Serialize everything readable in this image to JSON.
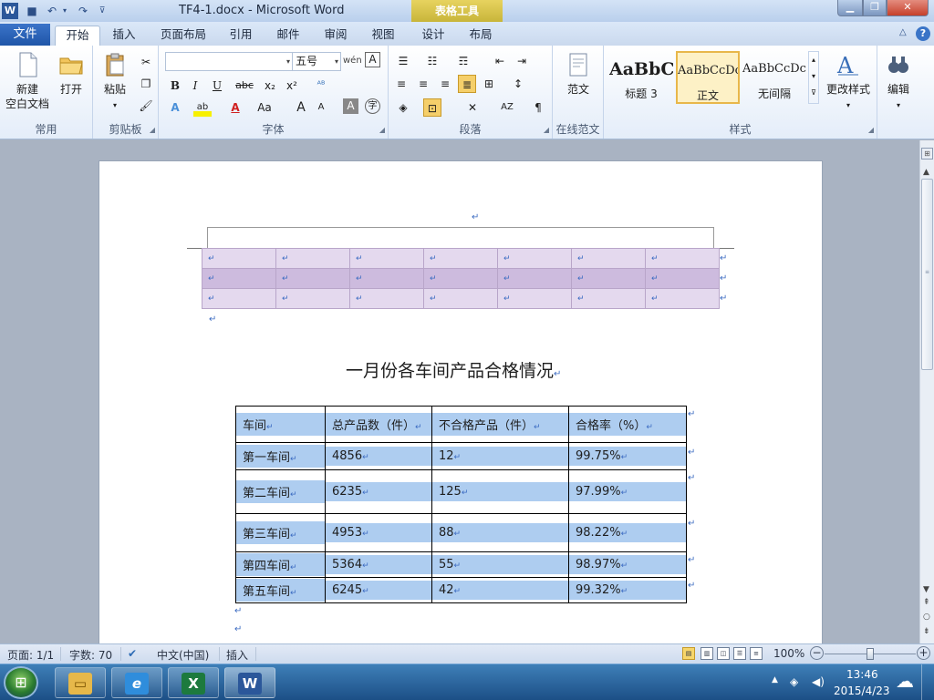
{
  "window": {
    "title": "TF4-1.docx - Microsoft Word",
    "context_tab": "表格工具",
    "logo_letter": "W",
    "minimize": "▁",
    "maximize": "❐",
    "close": "✕"
  },
  "qat": {
    "save": "■",
    "undo": "↶",
    "dropdown": "▾",
    "redo": "↷",
    "customize": "⊽"
  },
  "tabs": {
    "file": "文件",
    "items": [
      "开始",
      "插入",
      "页面布局",
      "引用",
      "邮件",
      "审阅",
      "视图",
      "设计",
      "布局"
    ],
    "help": "?",
    "minimize_ribbon": "△"
  },
  "ribbon": {
    "common": {
      "label": "常用",
      "new_line1": "新建",
      "new_line2": "空白文档",
      "open": "打开"
    },
    "clipboard": {
      "label": "剪贴板",
      "paste": "粘贴"
    },
    "font": {
      "label": "字体",
      "font_name": "",
      "font_size": "五号",
      "bold": "B",
      "italic": "I",
      "underline": "U",
      "strike": "abc",
      "sub": "x₂",
      "sup": "x²",
      "grow": "A",
      "shrink": "A",
      "case": "Aa"
    },
    "paragraph": {
      "label": "段落"
    },
    "template": {
      "label": "在线范文",
      "button": "范文"
    },
    "styles": {
      "label": "样式",
      "items": [
        {
          "sample": "AaBbC",
          "name": "标题 3"
        },
        {
          "sample": "AaBbCcDc",
          "name": "正文"
        },
        {
          "sample": "AaBbCcDc",
          "name": "无间隔"
        }
      ],
      "change_styles": "更改样式"
    },
    "editing": {
      "label": "编辑"
    }
  },
  "document": {
    "paragraph_mark": "↵",
    "title": "一月份各车间产品合格情况",
    "table_headers": [
      "车间",
      "总产品数（件）",
      "不合格产品（件）",
      "合格率（%）"
    ],
    "table_rows": [
      [
        "第一车间",
        "4856",
        "12",
        "99.75%"
      ],
      [
        "第二车间",
        "6235",
        "125",
        "97.99%"
      ],
      [
        "第三车间",
        "4953",
        "88",
        "98.22%"
      ],
      [
        "第四车间",
        "5364",
        "55",
        "98.97%"
      ],
      [
        "第五车间",
        "6245",
        "42",
        "99.32%"
      ]
    ]
  },
  "status": {
    "page": "页面: 1/1",
    "words": "字数: 70",
    "language": "中文(中国)",
    "insert": "插入",
    "zoom": "100%"
  },
  "taskbar": {
    "time": "13:46",
    "date": "2015/4/23"
  }
}
